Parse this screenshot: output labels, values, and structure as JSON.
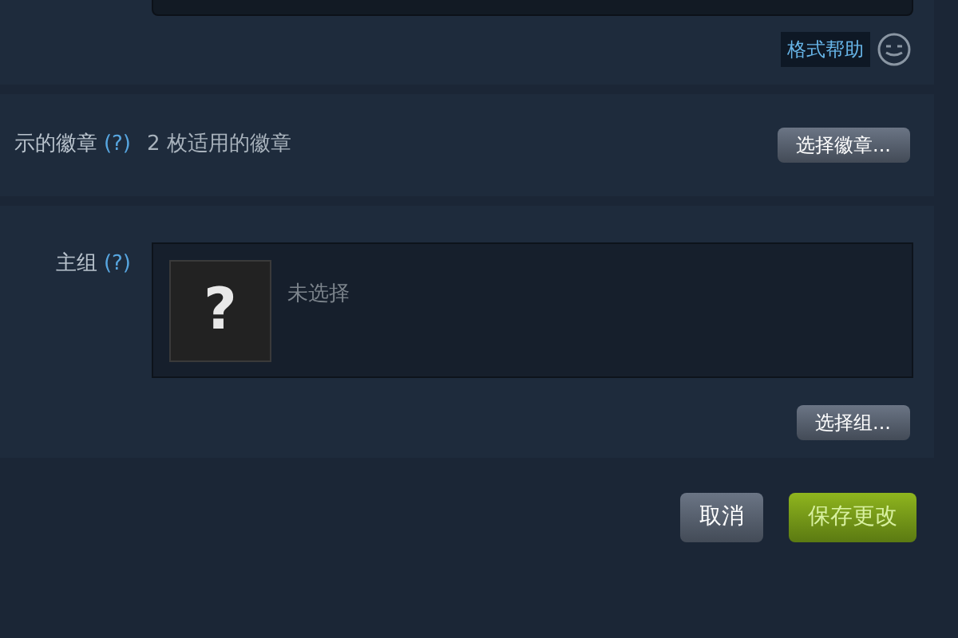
{
  "format_help": {
    "label": "格式帮助"
  },
  "badges": {
    "label": "示的徽章",
    "help": "(?)",
    "summary": "2 枚适用的徽章",
    "button": "选择徽章..."
  },
  "group": {
    "label": "主组",
    "help": "(?)",
    "placeholder_mark": "?",
    "value": "未选择",
    "button": "选择组..."
  },
  "actions": [
    {
      "label": "取消",
      "kind": "secondary"
    },
    {
      "label": "保存更改",
      "kind": "primary"
    }
  ]
}
